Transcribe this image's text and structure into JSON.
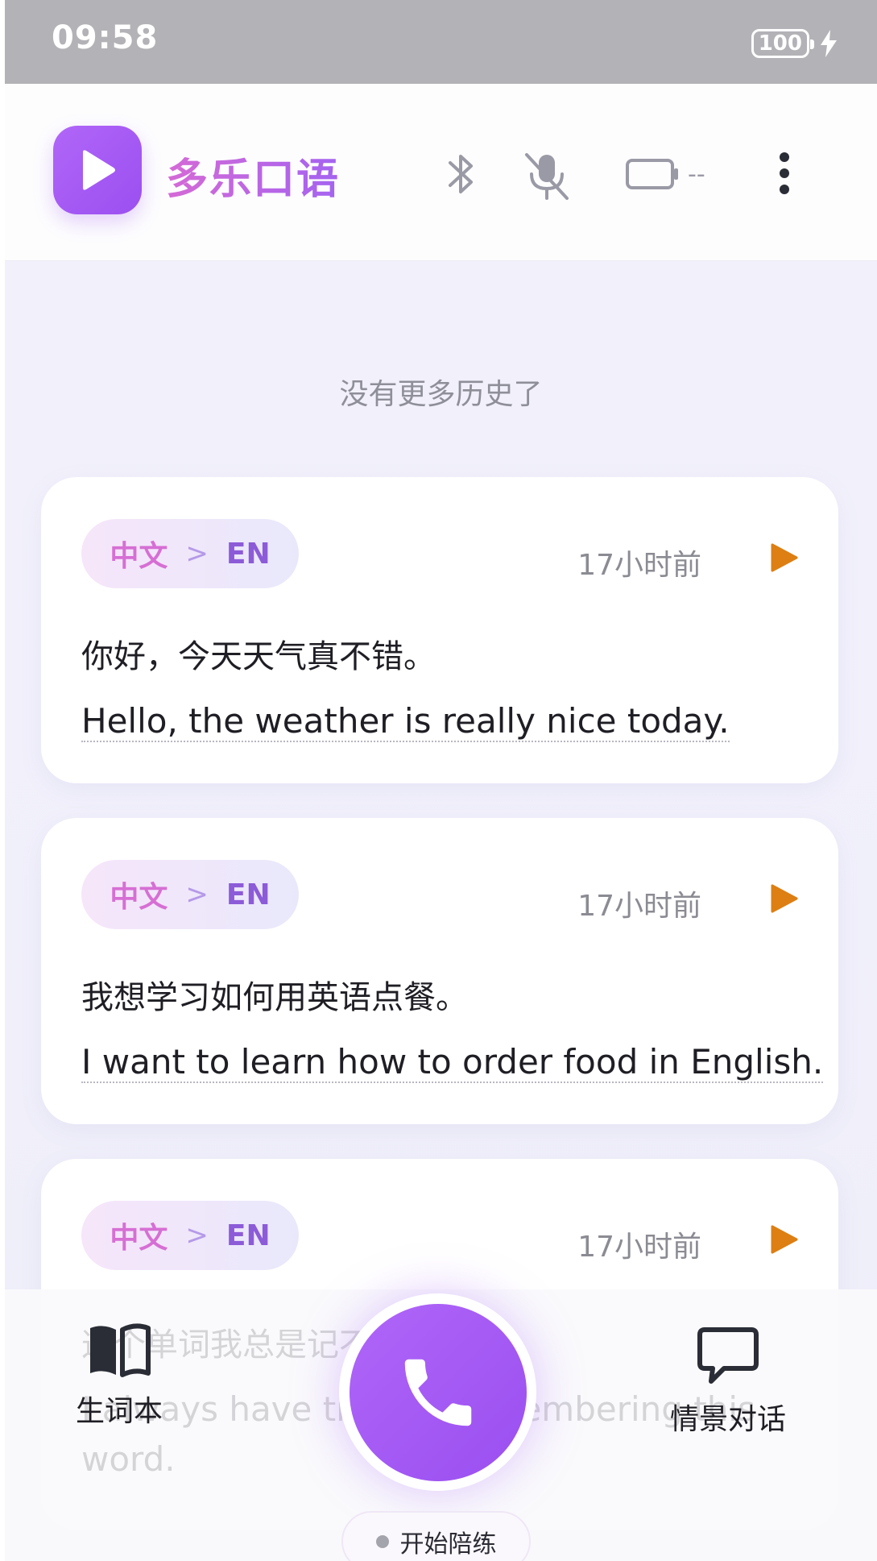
{
  "status_bar": {
    "time": "09:58",
    "battery_level": "100"
  },
  "header": {
    "app_title": "多乐口语",
    "device_battery_text": "--"
  },
  "history_hint": "没有更多历史了",
  "cards": [
    {
      "src_lang": "中文",
      "dst_lang": "EN",
      "time": "17小时前",
      "zh": "你好，今天天气真不错。",
      "en": "Hello, the weather is really nice today."
    },
    {
      "src_lang": "中文",
      "dst_lang": "EN",
      "time": "17小时前",
      "zh": "我想学习如何用英语点餐。",
      "en": "I want to learn how to order food in English."
    },
    {
      "src_lang": "中文",
      "dst_lang": "EN",
      "time": "17小时前",
      "zh": "这个单词我总是记不住。",
      "en_line1": "I always have trouble remembering this",
      "en_line2": "word."
    }
  ],
  "bottom_nav": {
    "vocab_label": "生词本",
    "scene_label": "情景对话",
    "start_label": "开始陪练"
  },
  "colors": {
    "brand_purple": "#9b4ff0",
    "play_orange": "#dd7f12",
    "title_pink": "#d56ad6"
  }
}
